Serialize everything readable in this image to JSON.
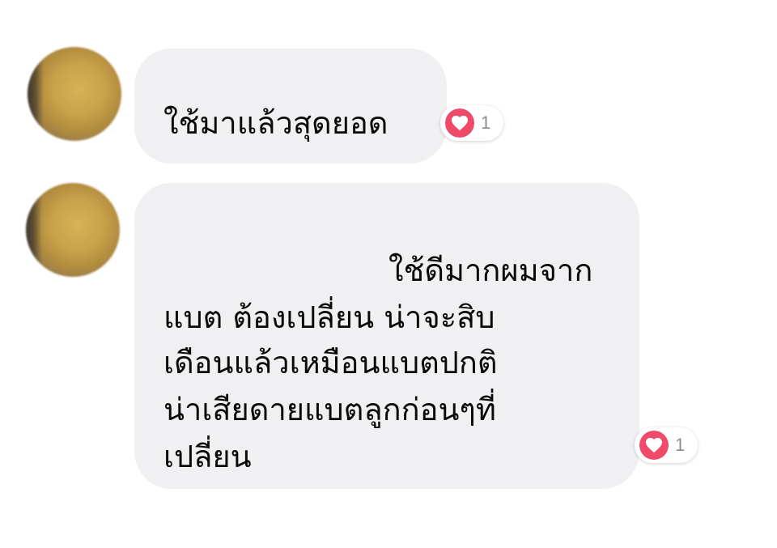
{
  "messages": [
    {
      "text": "ใช้มาแล้วสุดยอด",
      "reaction": {
        "icon": "heart-icon",
        "count": "1",
        "color": "#f04a6a"
      }
    },
    {
      "lines": [
        "ใช้ดีมากผมจาก",
        "แบต ต้องเปลี่ยน น่าจะสิบ",
        "เดือนแล้วเหมือนแบตปกติ",
        "น่าเสียดายแบตลูกก่อนๆที่",
        "เปลี่ยน"
      ],
      "reaction": {
        "icon": "heart-icon",
        "count": "1",
        "color": "#f04a6a"
      }
    }
  ],
  "colors": {
    "bubble_bg": "#f0f0f3",
    "reaction_heart": "#f04a6a",
    "count_text": "#8a8d91"
  }
}
